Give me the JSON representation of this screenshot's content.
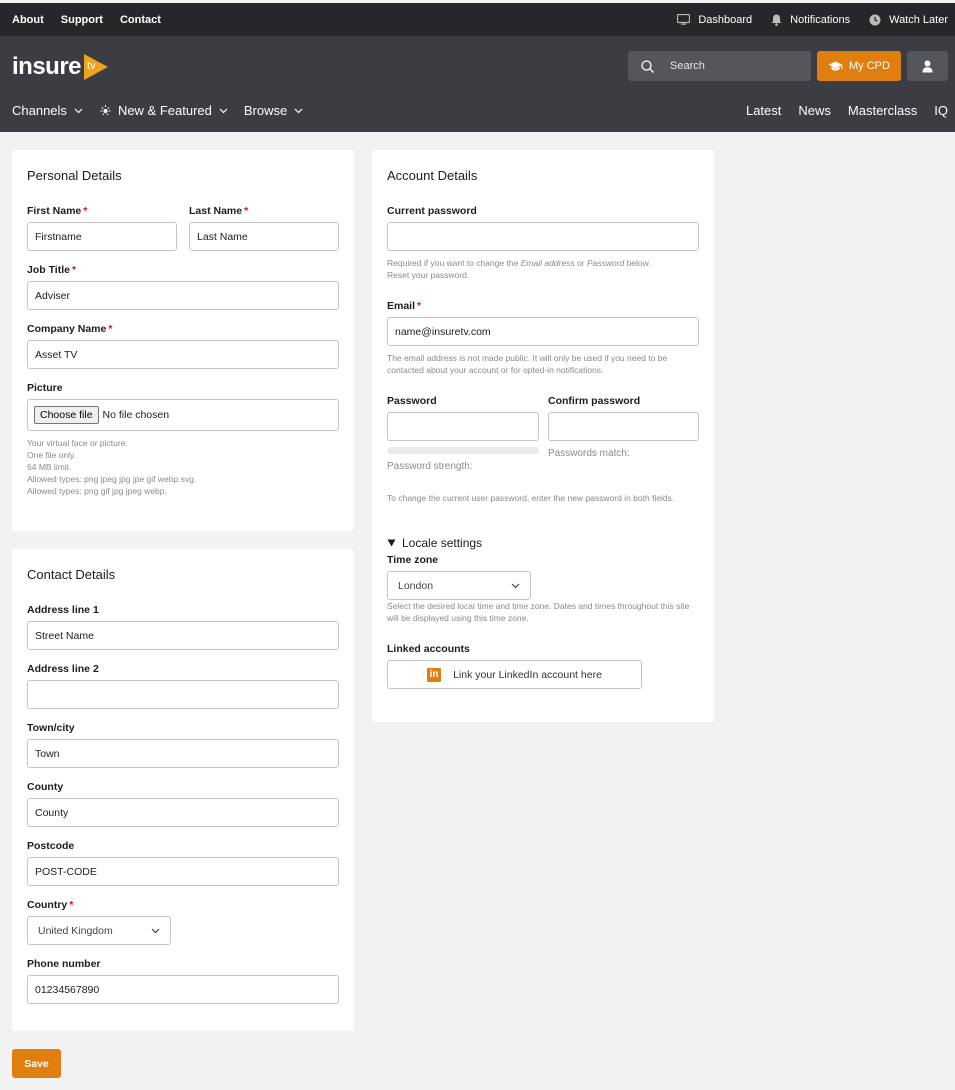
{
  "topbar": {
    "links": [
      "About",
      "Support",
      "Contact"
    ],
    "dashboard": "Dashboard",
    "notifications": "Notifications",
    "watch_later": "Watch Later"
  },
  "header": {
    "logo_text": "insure",
    "logo_badge": "tv",
    "search_placeholder": "Search",
    "cpd_label": "My CPD",
    "nav_left": [
      "Channels",
      "New & Featured",
      "Browse"
    ],
    "nav_right": [
      "Latest",
      "News",
      "Masterclass",
      "IQ"
    ]
  },
  "personal": {
    "title": "Personal Details",
    "first_name_label": "First Name",
    "first_name_value": "Firstname",
    "last_name_label": "Last Name",
    "last_name_value": "Last Name",
    "job_title_label": "Job Title",
    "job_title_value": "Adviser",
    "company_label": "Company Name",
    "company_value": "Asset TV",
    "picture_label": "Picture",
    "choose_file": "Choose file",
    "no_file": "No file chosen",
    "picture_help": [
      "Your virtual face or picture.",
      "One file only.",
      "64 MB limit.",
      "Allowed types: png jpeg jpg jpe gif webp svg.",
      "Allowed types: png gif jpg jpeg webp."
    ]
  },
  "contact": {
    "title": "Contact Details",
    "address1_label": "Address line 1",
    "address1_value": "Street Name",
    "address2_label": "Address line 2",
    "address2_value": "",
    "town_label": "Town/city",
    "town_value": "Town",
    "county_label": "County",
    "county_value": "County",
    "postcode_label": "Postcode",
    "postcode_value": "POST-CODE",
    "country_label": "Country",
    "country_value": "United Kingdom",
    "phone_label": "Phone number",
    "phone_value": "01234567890"
  },
  "account": {
    "title": "Account Details",
    "current_password_label": "Current password",
    "current_password_help_a": "Required if you want to change the ",
    "current_password_help_em1": "Email address",
    "current_password_help_b": " or ",
    "current_password_help_em2": "Password",
    "current_password_help_c": " below.",
    "current_password_help_line2": "Reset your password.",
    "email_label": "Email",
    "email_value": "name@insuretv.com",
    "email_help": "The email address is not made public. It will only be used if you need to be contacted about your account or for opted-in notifications.",
    "password_label": "Password",
    "confirm_label": "Confirm password",
    "strength_label": "Password strength:",
    "match_label": "Passwords match:",
    "password_help": "To change the current user password, enter the new password in both fields.",
    "locale_title": "Locale settings",
    "timezone_label": "Time zone",
    "timezone_value": "London",
    "timezone_help": "Select the desired local time and time zone. Dates and times throughout this site will be displayed using this time zone.",
    "linked_label": "Linked accounts",
    "linkedin_button": "Link your LinkedIn account here"
  },
  "save_label": "Save",
  "colors": {
    "accent": "#e07f10",
    "topbar": "#27272b",
    "header": "#3c3c43",
    "required": "#d0131e"
  }
}
